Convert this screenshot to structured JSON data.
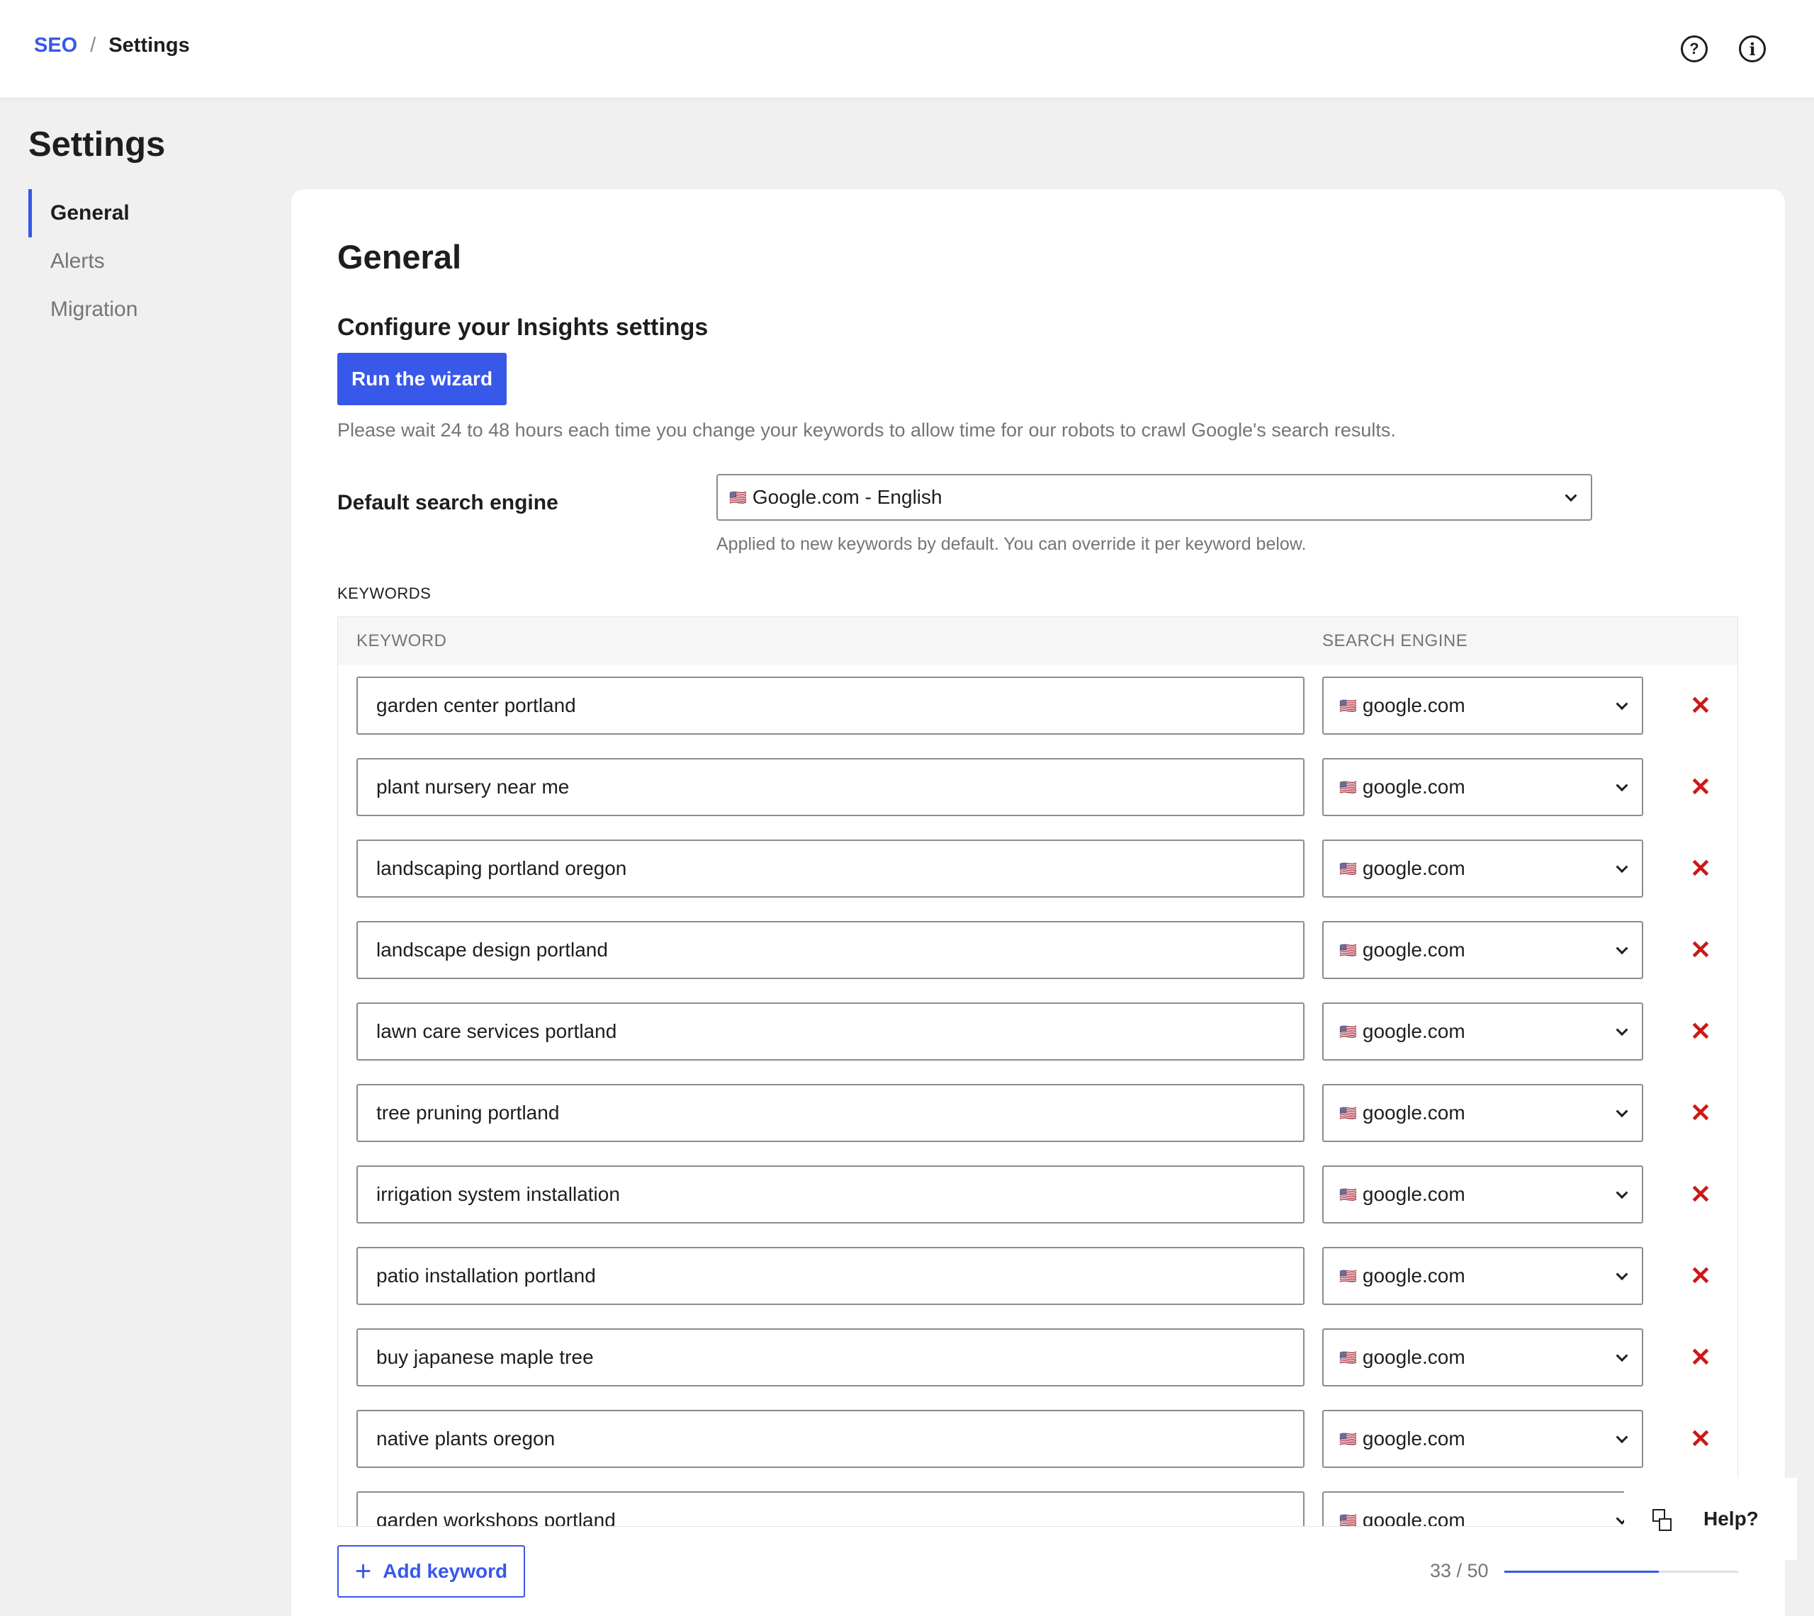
{
  "breadcrumb": {
    "parent": "SEO",
    "separator": "/",
    "current": "Settings"
  },
  "header_icons": {
    "help": "?",
    "info": "i"
  },
  "page_title": "Settings",
  "sidebar": {
    "items": [
      {
        "label": "General",
        "active": true
      },
      {
        "label": "Alerts",
        "active": false
      },
      {
        "label": "Migration",
        "active": false
      }
    ]
  },
  "main": {
    "title": "General",
    "subtitle": "Configure your Insights settings",
    "wizard_button": "Run the wizard",
    "notice": "Please wait 24 to 48 hours each time you change your keywords to allow time for our robots to crawl Google's search results.",
    "default_engine": {
      "label": "Default search engine",
      "flag": "🇺🇸",
      "value": "Google.com - English",
      "help": "Applied to new keywords by default. You can override it per keyword below."
    },
    "keywords_label": "KEYWORDS",
    "table": {
      "headers": {
        "keyword": "KEYWORD",
        "engine": "SEARCH ENGINE"
      },
      "rows": [
        {
          "keyword": "garden center portland",
          "flag": "🇺🇸",
          "engine": "google.com",
          "remove": "✕"
        },
        {
          "keyword": "plant nursery near me",
          "flag": "🇺🇸",
          "engine": "google.com",
          "remove": "✕"
        },
        {
          "keyword": "landscaping portland oregon",
          "flag": "🇺🇸",
          "engine": "google.com",
          "remove": "✕"
        },
        {
          "keyword": "landscape design portland",
          "flag": "🇺🇸",
          "engine": "google.com",
          "remove": "✕"
        },
        {
          "keyword": "lawn care services portland",
          "flag": "🇺🇸",
          "engine": "google.com",
          "remove": "✕"
        },
        {
          "keyword": "tree pruning portland",
          "flag": "🇺🇸",
          "engine": "google.com",
          "remove": "✕"
        },
        {
          "keyword": "irrigation system installation",
          "flag": "🇺🇸",
          "engine": "google.com",
          "remove": "✕"
        },
        {
          "keyword": "patio installation portland",
          "flag": "🇺🇸",
          "engine": "google.com",
          "remove": "✕"
        },
        {
          "keyword": "buy japanese maple tree",
          "flag": "🇺🇸",
          "engine": "google.com",
          "remove": "✕"
        },
        {
          "keyword": "native plants oregon",
          "flag": "🇺🇸",
          "engine": "google.com",
          "remove": "✕"
        },
        {
          "keyword": "garden workshops portland",
          "flag": "🇺🇸",
          "engine": "google.com",
          "remove": "✕"
        }
      ]
    },
    "add_button": {
      "icon": "+",
      "label": "Add keyword"
    },
    "usage": {
      "text": "33 / 50",
      "used": 33,
      "limit": 50
    }
  },
  "help_widget": {
    "label": "Help?"
  },
  "colors": {
    "accent": "#3858e9",
    "danger": "#cc1818",
    "muted": "#757575"
  }
}
